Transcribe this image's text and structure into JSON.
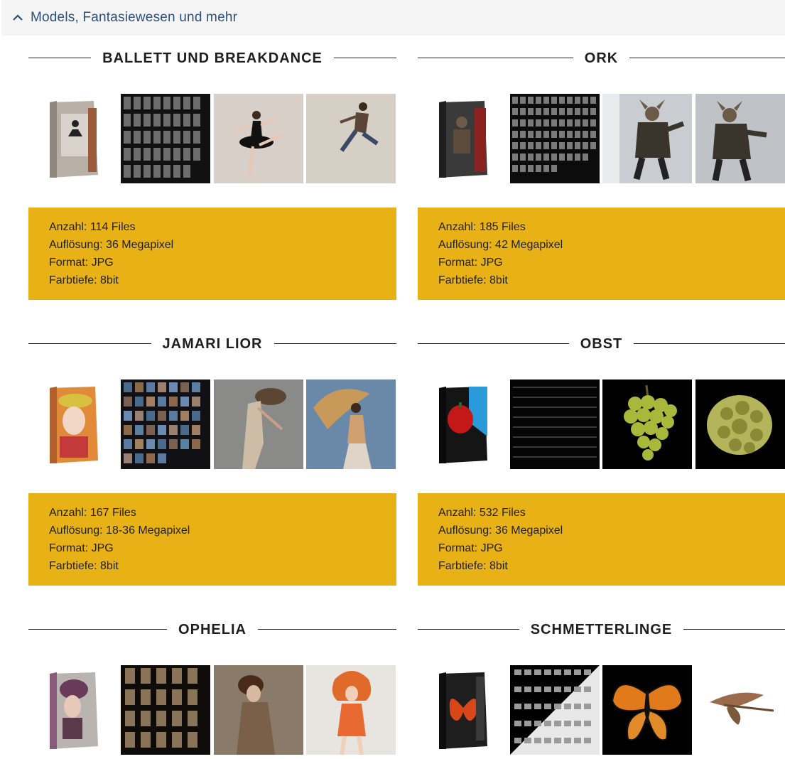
{
  "accordion": {
    "title": "Models, Fantasiewesen und mehr",
    "icon": "chevron-up-icon"
  },
  "colors": {
    "accent": "#e8b116",
    "header_text": "#2c4f7c",
    "header_bg": "#f5f5f5"
  },
  "products": [
    {
      "title": "BALLETT UND BREAKDANCE",
      "anzahl": "Anzahl: 114 Files",
      "aufloesung": "Auflösung: 36 Megapixel",
      "format": "Format: JPG",
      "farbtiefe": "Farbtiefe: 8bit"
    },
    {
      "title": "ORK",
      "anzahl": "Anzahl: 185 Files",
      "aufloesung": "Auflösung: 42 Megapixel",
      "format": "Format: JPG",
      "farbtiefe": "Farbtiefe: 8bit"
    },
    {
      "title": "JAMARI LIOR",
      "anzahl": "Anzahl: 167 Files",
      "aufloesung": "Auflösung: 18-36 Megapixel",
      "format": "Format: JPG",
      "farbtiefe": "Farbtiefe: 8bit"
    },
    {
      "title": "OBST",
      "anzahl": "Anzahl: 532 Files",
      "aufloesung": "Auflösung: 36 Megapixel",
      "format": "Format: JPG",
      "farbtiefe": "Farbtiefe: 8bit"
    },
    {
      "title": "OPHELIA"
    },
    {
      "title": "SCHMETTERLINGE"
    }
  ]
}
